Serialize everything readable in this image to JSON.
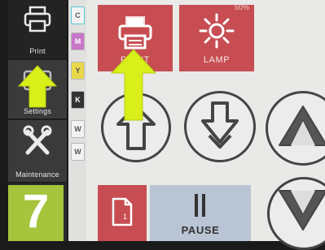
{
  "sidebar": {
    "items": [
      {
        "label": "Print",
        "icon": "printer-icon",
        "active": true
      },
      {
        "label": "Settings",
        "icon": "settings-icon",
        "active": false
      },
      {
        "label": "Maintenance",
        "icon": "tools-icon",
        "active": false
      }
    ]
  },
  "inks": [
    {
      "label": "C",
      "color": "#5bc7d6"
    },
    {
      "label": "M",
      "color": "#c876c8"
    },
    {
      "label": "Y",
      "color": "#e8d84a"
    },
    {
      "label": "K",
      "color": "#333333"
    },
    {
      "label": "W",
      "color": "#f5f5f5"
    },
    {
      "label": "W",
      "color": "#f5f5f5"
    }
  ],
  "tiles": {
    "print": {
      "label": "PRINT",
      "icon": "printer-icon"
    },
    "lamp": {
      "label": "LAMP",
      "icon": "lamp-icon",
      "percent": "50%"
    },
    "job": {
      "label": "1",
      "icon": "document-icon"
    }
  },
  "controls": {
    "up": {
      "icon": "arrow-up-icon"
    },
    "down": {
      "icon": "arrow-down-icon"
    },
    "home": {
      "icon": "home-up-icon"
    },
    "eject": {
      "icon": "eject-down-icon"
    },
    "pause": {
      "label": "PAUSE",
      "icon": "pause-icon"
    }
  },
  "step": {
    "number": "7"
  },
  "colors": {
    "accent_red": "#c74d52",
    "pointer_green": "#d8ef1a",
    "step_green": "#a6c43c",
    "pause_blue": "#b9c5d4"
  }
}
